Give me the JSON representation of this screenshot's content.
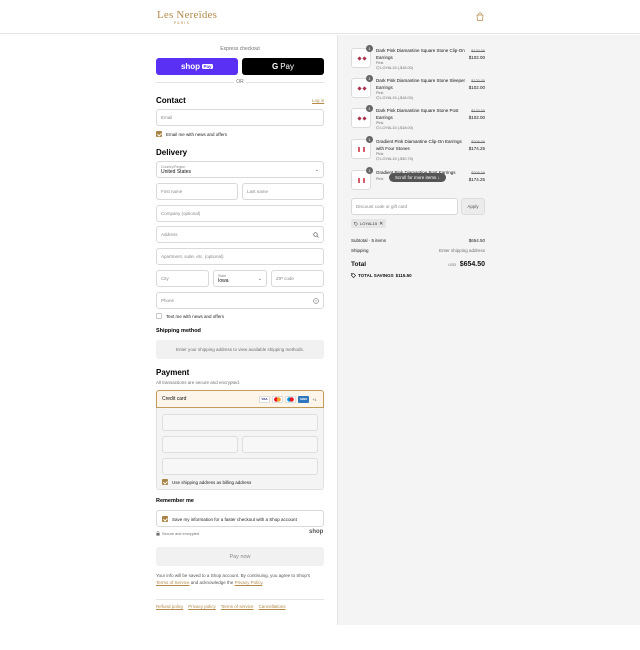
{
  "header": {
    "brand": "Les Nereïdes",
    "brand_sub": "PARIS",
    "cart_icon": "shopping-bag-icon"
  },
  "express": {
    "label": "Express checkout",
    "shop_pay_label": "shop",
    "shop_pay_badge": "Pay",
    "gpay_g": "G",
    "gpay_label": "Pay",
    "or": "OR"
  },
  "contact": {
    "title": "Contact",
    "login": "Log in",
    "email_placeholder": "Email",
    "email_news_label": "Email me with news and offers",
    "email_news_checked": true
  },
  "delivery": {
    "title": "Delivery",
    "country_label": "Country/Region",
    "country_value": "United States",
    "first_name": "First name",
    "last_name": "Last name",
    "company": "Company (optional)",
    "address": "Address",
    "apartment": "Apartment, suite, etc. (optional)",
    "city": "City",
    "state_label": "State",
    "state_value": "Iowa",
    "zip": "ZIP code",
    "phone": "Phone",
    "text_news_label": "Text me with news and offers",
    "text_news_checked": false
  },
  "shipping": {
    "title": "Shipping method",
    "message": "Enter your shipping address to view available shipping methods."
  },
  "payment": {
    "title": "Payment",
    "subtitle": "All transactions are secure and encrypted.",
    "method": "Credit card",
    "cards": [
      "VISA",
      "MC",
      "MAESTRO",
      "AMEX",
      "+1"
    ],
    "billing_label": "Use shipping address as billing address",
    "billing_checked": true
  },
  "remember": {
    "title": "Remember me",
    "save_label": "Save my information for a faster checkout with a Shop account",
    "save_checked": true,
    "secure_label": "Secure and encrypted",
    "shop_logo": "shop"
  },
  "paynow": "Pay now",
  "legal": {
    "text1": "Your info will be saved to a Shop account. By continuing, you agree to Shop's",
    "terms": "Terms of Service",
    "text2": "and acknowledge the",
    "privacy": "Privacy Policy",
    "text3": "."
  },
  "footer": {
    "links": [
      "Refund policy",
      "Privacy policy",
      "Terms of service",
      "Cancellations"
    ]
  },
  "cart": {
    "items": [
      {
        "qty": "1",
        "name": "Dark Pink Diamantine Square Stone Clip-On Earrings",
        "variant": "Pink",
        "discount": "LOYAL15 (-$18.00)",
        "compare": "$120.00",
        "price": "$102.00",
        "gem_color": "#a8324a"
      },
      {
        "qty": "1",
        "name": "Dark Pink Diamantine Square Stone Sleeper Earrings",
        "variant": "Pink",
        "discount": "LOYAL15 (-$18.00)",
        "compare": "$120.00",
        "price": "$102.00",
        "gem_color": "#a8324a"
      },
      {
        "qty": "1",
        "name": "Dark Pink Diamantine Square Stone Post Earrings",
        "variant": "Pink",
        "discount": "LOYAL15 (-$18.00)",
        "compare": "$120.00",
        "price": "$102.00",
        "gem_color": "#a8324a"
      },
      {
        "qty": "1",
        "name": "Gradient Pink Diamantine Clip-On Earrings with Four Stones",
        "variant": "Pink",
        "discount": "LOYAL15 (-$30.75)",
        "compare": "$205.00",
        "price": "$174.25",
        "gem_color": "#d65a6a"
      },
      {
        "qty": "1",
        "name": "Gradient Pink Diamantine Post Earrings",
        "variant": "Pink",
        "discount": "",
        "compare": "$205.00",
        "price": "$174.25",
        "gem_color": "#d65a6a"
      }
    ],
    "scroll_hint": "Scroll for more items",
    "discount_placeholder": "Discount code or gift card",
    "apply": "Apply",
    "applied_code": "LOYAL15",
    "subtotal_label": "Subtotal · 5 items",
    "subtotal_value": "$654.50",
    "shipping_label": "Shipping",
    "shipping_value": "Enter shipping address",
    "total_label": "Total",
    "currency": "USD",
    "total_value": "$654.50",
    "savings_label": "TOTAL SAVINGS",
    "savings_value": "$115.50"
  },
  "colors": {
    "accent": "#b38a4a",
    "shop_pay": "#5a31f4"
  }
}
